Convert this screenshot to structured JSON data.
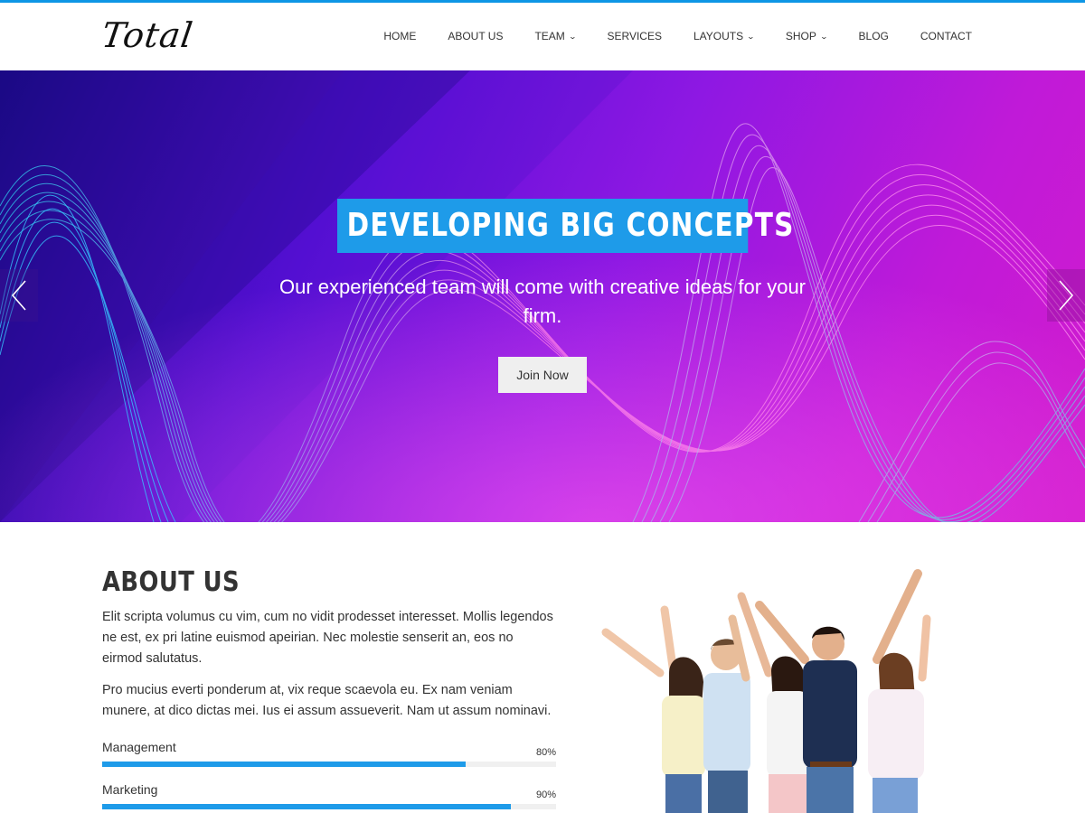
{
  "colors": {
    "accent": "#1e9be9",
    "topbar": "#0e96e5"
  },
  "header": {
    "logo": "Total",
    "nav": [
      {
        "label": "HOME",
        "dropdown": false
      },
      {
        "label": "ABOUT US",
        "dropdown": false
      },
      {
        "label": "TEAM",
        "dropdown": true
      },
      {
        "label": "SERVICES",
        "dropdown": false
      },
      {
        "label": "LAYOUTS",
        "dropdown": true
      },
      {
        "label": "SHOP",
        "dropdown": true
      },
      {
        "label": "BLOG",
        "dropdown": false
      },
      {
        "label": "CONTACT",
        "dropdown": false
      }
    ]
  },
  "hero": {
    "title": "DEVELOPING BIG CONCEPTS",
    "subtitle": "Our experienced team will come with creative ideas for your firm.",
    "button": "Join Now",
    "prev_icon": "chevron-left-icon",
    "next_icon": "chevron-right-icon"
  },
  "about": {
    "title": "ABOUT US",
    "paragraphs": [
      "Elit scripta volumus cu vim, cum no vidit prodesset interesset. Mollis legendos ne est, ex pri latine euismod apeirian. Nec molestie senserit an, eos no eirmod salutatus.",
      "Pro mucius everti ponderum at, vix reque scaevola eu. Ex nam veniam munere, at dico dictas mei. Ius ei assum assueverit. Nam ut assum nominavi."
    ],
    "skills": [
      {
        "name": "Management",
        "percent_label": "80%",
        "value": 80
      },
      {
        "name": "Marketing",
        "percent_label": "90%",
        "value": 90
      }
    ],
    "image": "team-photo"
  }
}
